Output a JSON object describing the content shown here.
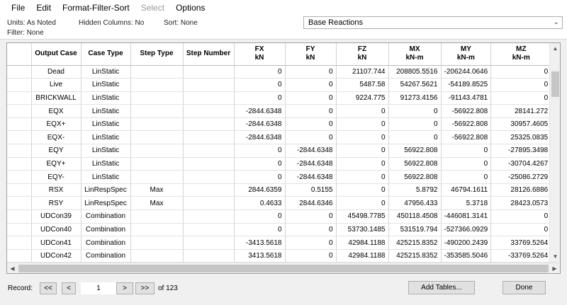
{
  "menubar": {
    "items": [
      {
        "label": "File",
        "enabled": true
      },
      {
        "label": "Edit",
        "enabled": true
      },
      {
        "label": "Format-Filter-Sort",
        "enabled": true
      },
      {
        "label": "Select",
        "enabled": false
      },
      {
        "label": "Options",
        "enabled": true
      }
    ]
  },
  "info": {
    "units": "Units:  As Noted",
    "hidden_columns": "Hidden Columns:  No",
    "sort": "Sort:  None",
    "filter": "Filter:  None"
  },
  "table_selector": {
    "value": "Base Reactions"
  },
  "grid": {
    "columns": [
      {
        "name": "Output Case",
        "unit": ""
      },
      {
        "name": "Case Type",
        "unit": ""
      },
      {
        "name": "Step Type",
        "unit": ""
      },
      {
        "name": "Step Number",
        "unit": ""
      },
      {
        "name": "FX",
        "unit": "kN"
      },
      {
        "name": "FY",
        "unit": "kN"
      },
      {
        "name": "FZ",
        "unit": "kN"
      },
      {
        "name": "MX",
        "unit": "kN-m"
      },
      {
        "name": "MY",
        "unit": "kN-m"
      },
      {
        "name": "MZ",
        "unit": "kN-m"
      }
    ],
    "rows": [
      [
        "Dead",
        "LinStatic",
        "",
        "",
        "0",
        "0",
        "21107.744",
        "208805.5516",
        "-206244.0646",
        "0"
      ],
      [
        "Live",
        "LinStatic",
        "",
        "",
        "0",
        "0",
        "5487.58",
        "54267.5621",
        "-54189.8525",
        "0"
      ],
      [
        "BRICKWALL",
        "LinStatic",
        "",
        "",
        "0",
        "0",
        "9224.775",
        "91273.4156",
        "-91143.4781",
        "0"
      ],
      [
        "EQX",
        "LinStatic",
        "",
        "",
        "-2844.6348",
        "0",
        "0",
        "0",
        "-56922.808",
        "28141.272"
      ],
      [
        "EQX+",
        "LinStatic",
        "",
        "",
        "-2844.6348",
        "0",
        "0",
        "0",
        "-56922.808",
        "30957.4605"
      ],
      [
        "EQX-",
        "LinStatic",
        "",
        "",
        "-2844.6348",
        "0",
        "0",
        "0",
        "-56922.808",
        "25325.0835"
      ],
      [
        "EQY",
        "LinStatic",
        "",
        "",
        "0",
        "-2844.6348",
        "0",
        "56922.808",
        "0",
        "-27895.3498"
      ],
      [
        "EQY+",
        "LinStatic",
        "",
        "",
        "0",
        "-2844.6348",
        "0",
        "56922.808",
        "0",
        "-30704.4267"
      ],
      [
        "EQY-",
        "LinStatic",
        "",
        "",
        "0",
        "-2844.6348",
        "0",
        "56922.808",
        "0",
        "-25086.2729"
      ],
      [
        "RSX",
        "LinRespSpec",
        "Max",
        "",
        "2844.6359",
        "0.5155",
        "0",
        "5.8792",
        "46794.1611",
        "28126.6886"
      ],
      [
        "RSY",
        "LinRespSpec",
        "Max",
        "",
        "0.4633",
        "2844.6346",
        "0",
        "47956.433",
        "5.3718",
        "28423.0573"
      ],
      [
        "UDCon39",
        "Combination",
        "",
        "",
        "0",
        "0",
        "45498.7785",
        "450118.4508",
        "-446081.3141",
        "0"
      ],
      [
        "UDCon40",
        "Combination",
        "",
        "",
        "0",
        "0",
        "53730.1485",
        "531519.794",
        "-527366.0929",
        "0"
      ],
      [
        "UDCon41",
        "Combination",
        "",
        "",
        "-3413.5618",
        "0",
        "42984.1188",
        "425215.8352",
        "-490200.2439",
        "33769.5264"
      ],
      [
        "UDCon42",
        "Combination",
        "",
        "",
        "3413.5618",
        "0",
        "42984.1188",
        "425215.8352",
        "-353585.5046",
        "-33769.5264"
      ]
    ]
  },
  "footer": {
    "record_label": "Record:",
    "first": "<<",
    "prev": "<",
    "record_value": "1",
    "next": ">",
    "last": ">>",
    "of_count": "of 123",
    "add_tables": "Add Tables...",
    "done": "Done"
  },
  "scroll_icons": {
    "up": "triangle-up",
    "down": "triangle-down",
    "left": "triangle-left",
    "right": "triangle-right"
  }
}
